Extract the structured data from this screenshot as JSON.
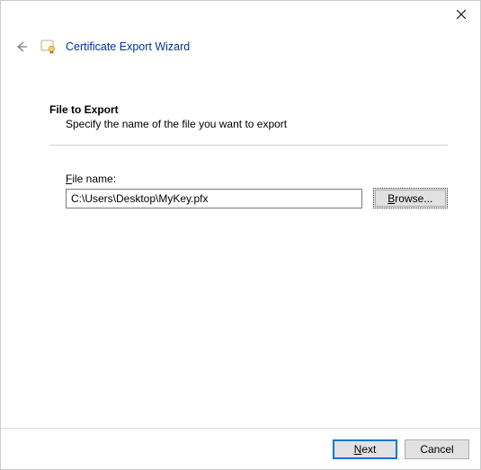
{
  "window": {
    "close_icon": "close"
  },
  "header": {
    "title": "Certificate Export Wizard"
  },
  "main": {
    "section_title": "File to Export",
    "section_desc": "Specify the name of the file you want to export",
    "filename_label_prefix": "F",
    "filename_label_rest": "ile name:",
    "filename_value": "C:\\Users\\Desktop\\MyKey.pfx",
    "browse_label_prefix": "B",
    "browse_label_rest": "rowse..."
  },
  "footer": {
    "next_prefix": "N",
    "next_rest": "ext",
    "cancel": "Cancel"
  }
}
